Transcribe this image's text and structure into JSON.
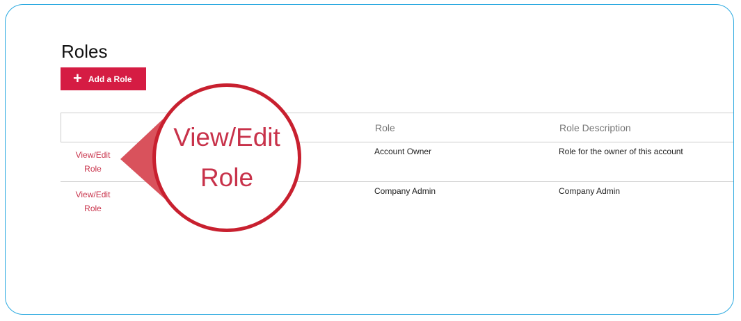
{
  "page": {
    "title": "Roles"
  },
  "toolbar": {
    "add_label": "Add a Role",
    "add_icon": "plus-icon"
  },
  "table": {
    "headers": [
      "",
      "Role",
      "Role Description"
    ],
    "rows": [
      {
        "action_line1": "View/Edit",
        "action_line2": "Role",
        "role": "Account Owner",
        "description": "Role for the owner of this account"
      },
      {
        "action_line1": "View/Edit",
        "action_line2": "Role",
        "role": "Company Admin",
        "description": "Company Admin"
      }
    ]
  },
  "callout": {
    "line1": "View/Edit",
    "line2": "Role"
  },
  "colors": {
    "accent": "#d51c43",
    "frame": "#2aa9e0",
    "callout": "#c8202f"
  }
}
